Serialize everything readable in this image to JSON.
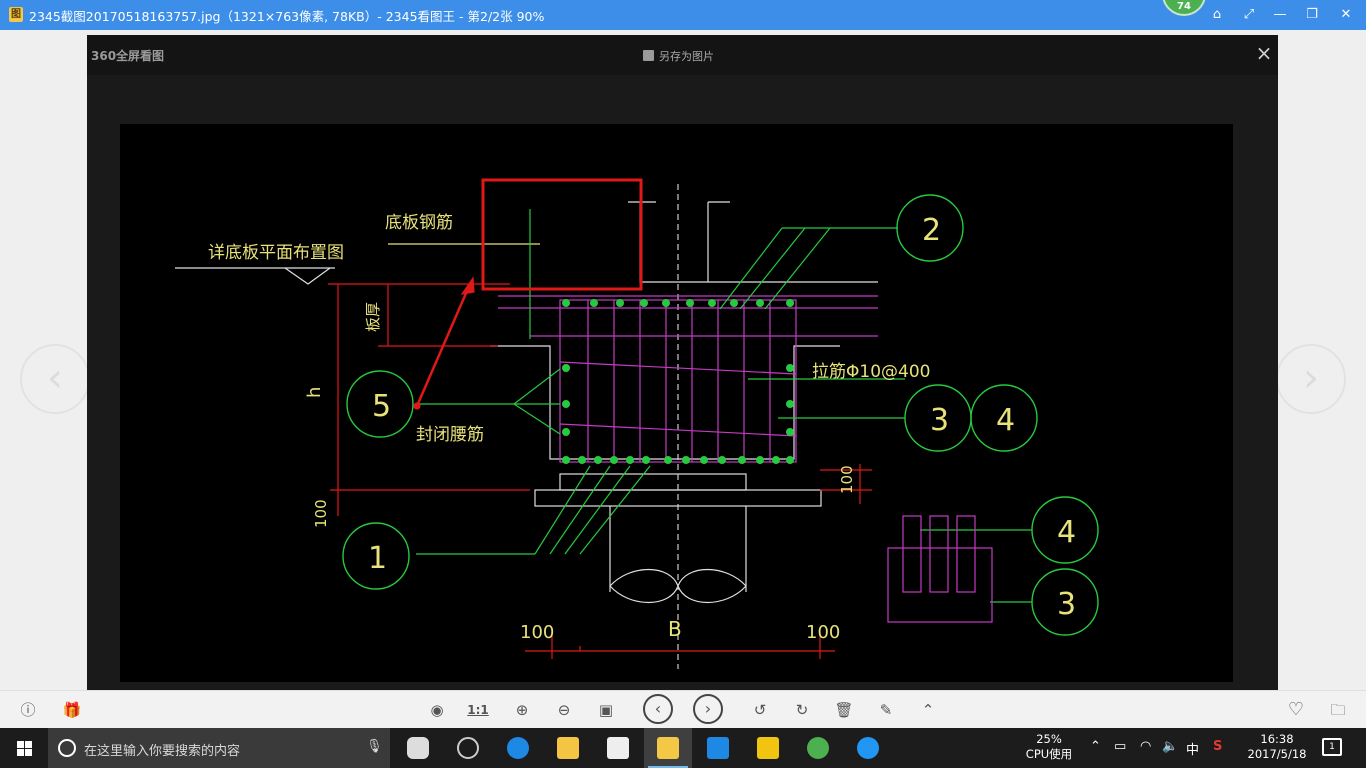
{
  "window": {
    "title": "2345截图20170518163757.jpg（1321×763像素, 78KB）- 2345看图王 - 第2/2张 90%",
    "badge": "74",
    "app_icon_char": "图"
  },
  "overlay": {
    "logo": "360全屏看图",
    "save_label": "另存为图片",
    "close": "×"
  },
  "drawing": {
    "labels": {
      "floor_rebar": "底板钢筋",
      "floor_plan_ref": "详底板平面布置图",
      "slab_thickness": "板厚",
      "height": "h",
      "tie_bar": "拉筋Φ10@400",
      "closed_waist_bar": "封闭腰筋",
      "dim_100_right": "100",
      "dim_100_left_vertical": "100",
      "dim_100_bottom_left": "100",
      "dim_100_bottom_right": "100",
      "width": "B"
    },
    "callouts": [
      "1",
      "2",
      "3",
      "4",
      "5",
      "4",
      "3"
    ]
  },
  "toolbar": {
    "info": "ⓘ",
    "gift": "🎁",
    "one_to_one": "1:1",
    "prev": "‹",
    "next": "›",
    "heart": "♡",
    "folder": "🗀"
  },
  "taskbar": {
    "search_placeholder": "在这里输入你要搜索的内容",
    "cpu_percent": "25%",
    "cpu_label": "CPU使用",
    "ime": "中",
    "time": "16:38",
    "date": "2017/5/18",
    "notifications": "1"
  },
  "colors": {
    "titlebar": "#3c8ee8",
    "cad_green": "#27c93f",
    "cad_yellow": "#e8e27a",
    "cad_magenta": "#c43bc4",
    "cad_red": "#e01818",
    "highlight_box": "#e01818"
  }
}
